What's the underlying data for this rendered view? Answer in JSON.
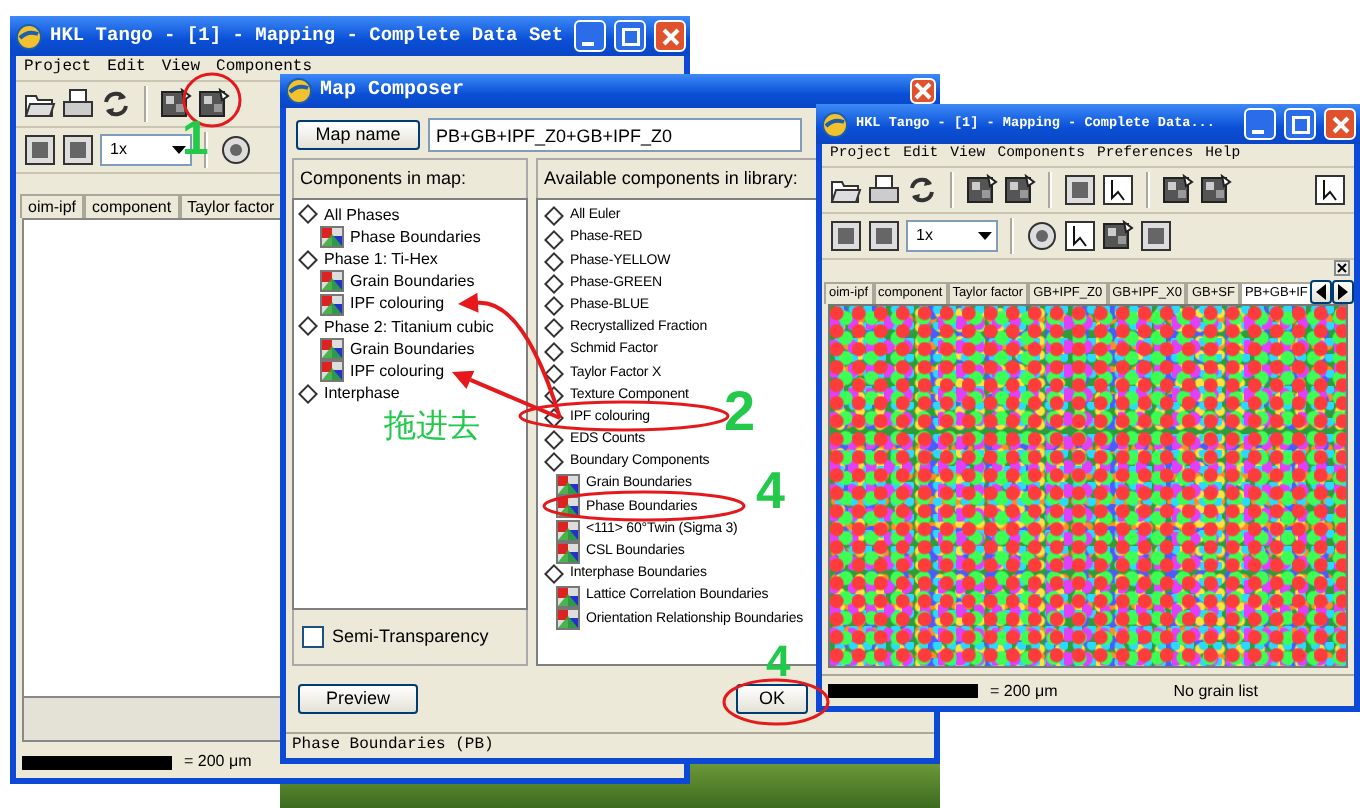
{
  "main_window": {
    "title": "HKL Tango - [1] - Mapping - Complete Data Set",
    "menu": [
      "Project",
      "Edit",
      "View",
      "Components"
    ],
    "zoom_select": "1x",
    "tabs": [
      {
        "label": "oim-ipf",
        "selected": false
      },
      {
        "label": "component",
        "selected": false
      },
      {
        "label": "Taylor factor",
        "selected": false
      }
    ],
    "status_bar": {
      "scale": "= 200 μm"
    }
  },
  "dialog": {
    "title": "Map Composer",
    "map_name_button": "Map name",
    "map_name_value": "PB+GB+IPF_Z0+GB+IPF_Z0",
    "components_header": "Components in map:",
    "components": [
      {
        "label": "All Phases",
        "children": [
          {
            "label": "Phase Boundaries"
          }
        ]
      },
      {
        "label": "Phase 1: Ti-Hex",
        "children": [
          {
            "label": "Grain Boundaries"
          },
          {
            "label": "IPF colouring"
          }
        ]
      },
      {
        "label": "Phase 2: Titanium cubic",
        "children": [
          {
            "label": "Grain Boundaries"
          },
          {
            "label": "IPF colouring"
          }
        ]
      },
      {
        "label": "Interphase"
      }
    ],
    "semi_transparency": {
      "label": "Semi-Transparency",
      "checked": false
    },
    "library_header": "Available components in library:",
    "library": [
      {
        "label": "All Euler"
      },
      {
        "label": "Phase-RED"
      },
      {
        "label": "Phase-YELLOW"
      },
      {
        "label": "Phase-GREEN"
      },
      {
        "label": "Phase-BLUE"
      },
      {
        "label": "Recrystallized Fraction"
      },
      {
        "label": "Schmid Factor"
      },
      {
        "label": "Taylor Factor X"
      },
      {
        "label": "Texture Component"
      },
      {
        "label": "IPF colouring"
      },
      {
        "label": "EDS Counts"
      },
      {
        "label": "Boundary Components",
        "children": [
          {
            "label": "Grain Boundaries"
          },
          {
            "label": "Phase Boundaries"
          },
          {
            "label": "<111> 60°Twin (Sigma 3)"
          },
          {
            "label": "CSL Boundaries"
          }
        ]
      },
      {
        "label": "Interphase Boundaries",
        "children": [
          {
            "label": "Lattice Correlation Boundaries"
          },
          {
            "label": "Orientation Relationship Boundaries"
          }
        ]
      }
    ],
    "buttons": [
      "Preview",
      "OK"
    ],
    "status_bar": "Phase Boundaries (PB)"
  },
  "map_window": {
    "title": "HKL Tango - [1] - Mapping - Complete Data...",
    "menu": [
      "Project",
      "Edit",
      "View",
      "Components",
      "Preferences",
      "Help"
    ],
    "zoom_select": "1x",
    "tabs": [
      {
        "label": "oim-ipf",
        "selected": false
      },
      {
        "label": "component",
        "selected": false
      },
      {
        "label": "Taylor factor",
        "selected": false
      },
      {
        "label": "GB+IPF_Z0",
        "selected": false
      },
      {
        "label": "GB+IPF_X0",
        "selected": false
      },
      {
        "label": "GB+SF",
        "selected": false
      },
      {
        "label": "PB+GB+IF",
        "selected": true
      }
    ],
    "status_bar": {
      "scale": "= 200 μm",
      "grains": "No grain list"
    }
  },
  "annotations": [
    {
      "kind": "circle"
    },
    {
      "kind": "number",
      "text": "1"
    },
    {
      "kind": "circle"
    },
    {
      "kind": "number",
      "text": "2"
    },
    {
      "kind": "arrow"
    },
    {
      "kind": "arrow"
    },
    {
      "kind": "label",
      "text": "拖进去"
    },
    {
      "kind": "circle"
    },
    {
      "kind": "number",
      "text": "4"
    },
    {
      "kind": "circle"
    },
    {
      "kind": "number",
      "text": "4"
    }
  ]
}
